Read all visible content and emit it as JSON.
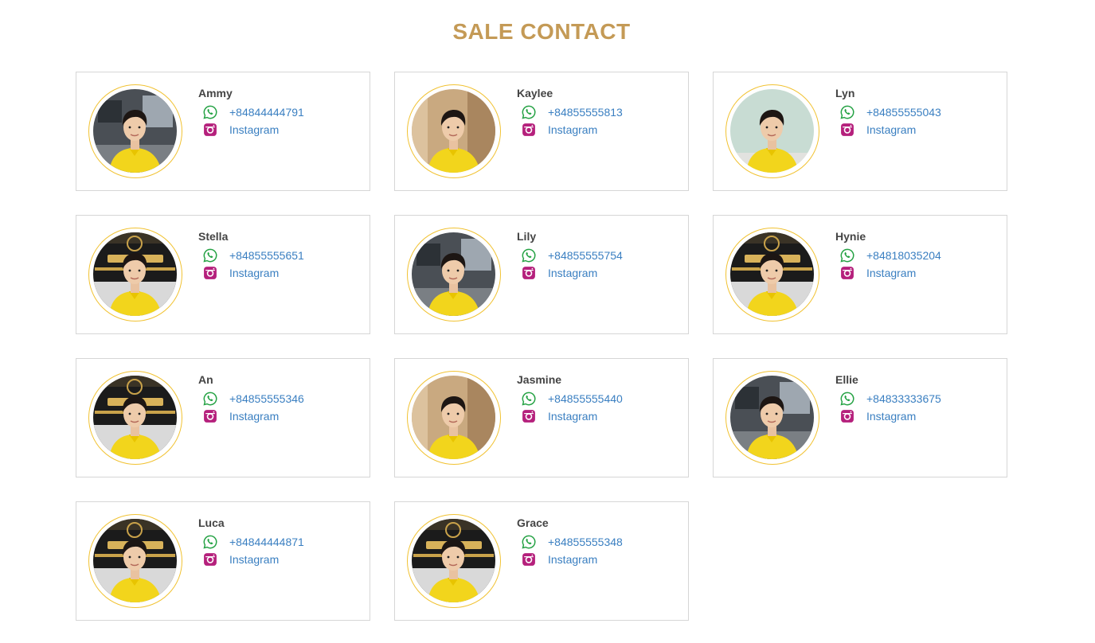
{
  "page": {
    "title": "SALE CONTACT"
  },
  "colors": {
    "title": "#c49a56",
    "ring": "#f1c232",
    "link": "#3a7fc1",
    "whatsapp": "#25a244",
    "instagram": "#b5207c",
    "shirt": "#f2d51c"
  },
  "icons": {
    "phone": "whatsapp-icon",
    "social": "instagram-icon"
  },
  "contacts": [
    {
      "name": "Ammy",
      "phone": "+84844444791",
      "social": "Instagram"
    },
    {
      "name": "Kaylee",
      "phone": "+84855555813",
      "social": "Instagram"
    },
    {
      "name": "Lyn",
      "phone": "+84855555043",
      "social": "Instagram"
    },
    {
      "name": "Stella",
      "phone": "+84855555651",
      "social": "Instagram"
    },
    {
      "name": "Lily",
      "phone": "+84855555754",
      "social": "Instagram"
    },
    {
      "name": "Hynie",
      "phone": "+84818035204",
      "social": "Instagram"
    },
    {
      "name": "An",
      "phone": "+84855555346",
      "social": "Instagram"
    },
    {
      "name": "Jasmine",
      "phone": "+84855555440",
      "social": "Instagram"
    },
    {
      "name": "Ellie",
      "phone": "+84833333675",
      "social": "Instagram"
    },
    {
      "name": "Luca",
      "phone": "+84844444871",
      "social": "Instagram"
    },
    {
      "name": "Grace",
      "phone": "+84855555348",
      "social": "Instagram"
    }
  ]
}
